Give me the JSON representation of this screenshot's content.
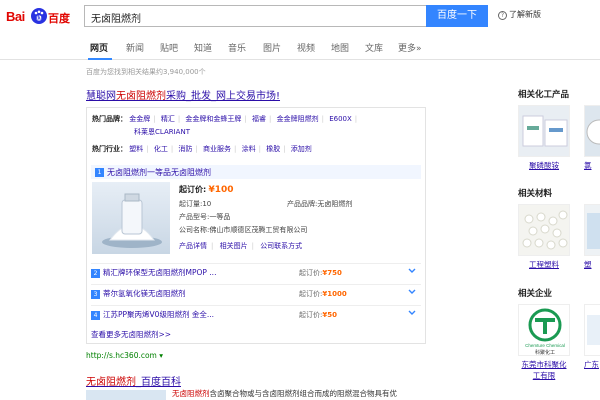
{
  "header": {
    "logo_text_bai": "Bai",
    "logo_text_cn": "百度",
    "search_value": "无卤阻燃剂",
    "search_button": "百度一下",
    "news_link": "了解新版"
  },
  "tabs": [
    "网页",
    "新闻",
    "贴吧",
    "知道",
    "音乐",
    "图片",
    "视频",
    "地图",
    "文库",
    "更多»"
  ],
  "result_count": "百度为您找到相关结果约3,940,000个",
  "result1": {
    "title_pre": "慧聪网",
    "title_em": "无卤阻燃剂",
    "title_post": "采购_批发_网上交易市场!",
    "brand_label": "热门品牌：",
    "brands_row1": [
      "金金牌",
      "精汇",
      "金金牌和金蜂王牌",
      "福睿",
      "金金牌阻燃剂",
      "E600X"
    ],
    "brands_row2": [
      "科莱恩CLARIANT"
    ],
    "industry_label": "热门行业：",
    "industries": [
      "塑料",
      "化工",
      "消防",
      "商业服务",
      "涂料",
      "橡胶",
      "添加剂"
    ],
    "featured": {
      "num": "1",
      "title": "无卤阻燃剂一等品无卤阻燃剂",
      "price_label": "起订价:",
      "price": "¥100",
      "moq": "起订量:10",
      "brand": "产品品牌:无卤阻燃剂",
      "model": "产品型号:一等品",
      "company": "公司名称:佛山市顺德区茂腾工贸有限公司",
      "links": [
        "产品详情",
        "相关图片",
        "公司联系方式"
      ]
    },
    "list": [
      {
        "num": "2",
        "name": "精汇牌环保型无卤阻燃剂MPOP ...",
        "price_label": "起订价:",
        "price": "¥750"
      },
      {
        "num": "3",
        "name": "蒂尔氢氧化镁无卤阻燃剂",
        "price_label": "起订价:",
        "price": "¥1000"
      },
      {
        "num": "4",
        "name": "江苏PP聚丙烯V0级阻燃剂 金全...",
        "price_label": "起订价:",
        "price": "¥50"
      }
    ],
    "more": "查看更多无卤阻燃剂>>",
    "url": "http://s.hc360.com"
  },
  "result2": {
    "title_em": "无卤阻燃剂",
    "title_post": "_百度百科",
    "snippet_em": "无卤阻燃剂",
    "snippet_post": "含卤聚合物或与含卤阻燃剂组合而成的阻燃混合物具有优"
  },
  "sidebar": {
    "sections": [
      {
        "title": "相关化工产品",
        "items": [
          "聚磷酸铵",
          "氯"
        ]
      },
      {
        "title": "相关材料",
        "items": [
          "工程塑料",
          "塑"
        ]
      },
      {
        "title": "相关企业",
        "items": [
          "东莞市科聚化工有限",
          "广东"
        ]
      }
    ],
    "logo_text": "Chemture Chemical",
    "logo_text_cn": "科聚化工"
  },
  "colors": {
    "link": "#2b0ea8",
    "accent": "#3385ff",
    "highlight": "#cc0000",
    "price": "#ff6600",
    "url": "#008000"
  }
}
